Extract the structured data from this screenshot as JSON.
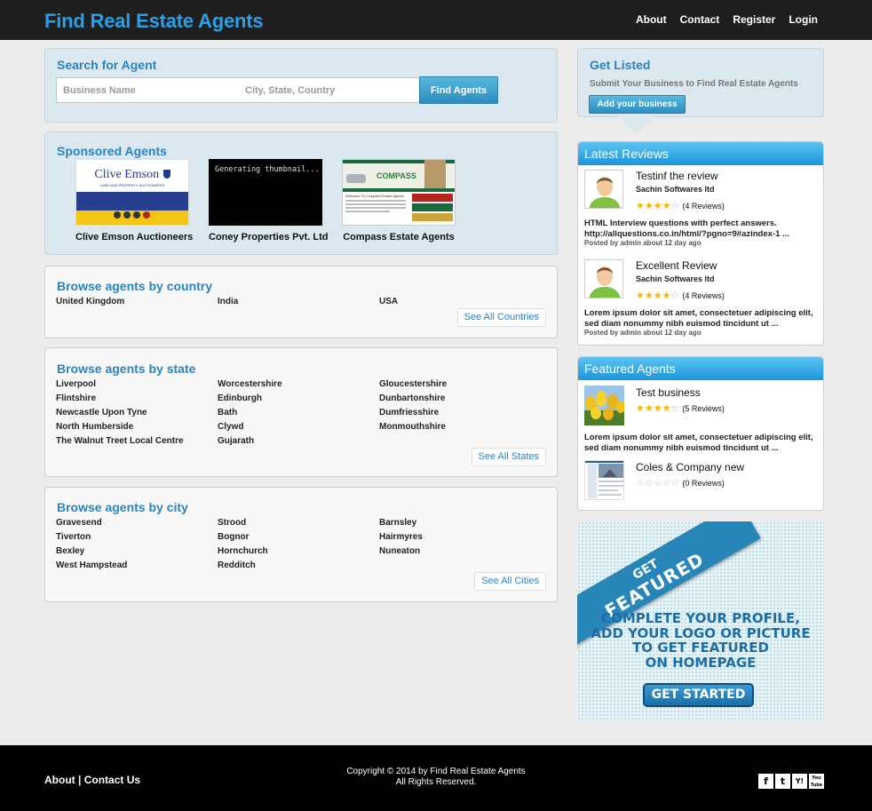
{
  "header": {
    "brand": "Find Real Estate Agents",
    "nav": [
      "About",
      "Contact",
      "Register",
      "Login"
    ]
  },
  "search": {
    "title": "Search for Agent",
    "business_placeholder": "Business Name",
    "location_placeholder": "City, State, Country",
    "button": "Find Agents"
  },
  "sponsored": {
    "title": "Sponsored Agents",
    "items": [
      {
        "name": "Clive Emson Auctioneers",
        "logo_text": "Clive Emson",
        "logo_sub": "LAND AND PROPERTY AUCTIONEERS"
      },
      {
        "name": "Coney Properties Pvt. Ltd",
        "thumb_text": "Generating thumbnail..."
      },
      {
        "name": "Compass Estate Agents",
        "logo_text": "COMPASS",
        "site_heading": "Welcome To Compass Estate Agents"
      }
    ]
  },
  "countries": {
    "title": "Browse agents by country",
    "items": [
      "United Kingdom",
      "India",
      "USA"
    ],
    "see_all": "See All Countries"
  },
  "states": {
    "title": "Browse agents by state",
    "items": [
      "Liverpool",
      "Worcestershire",
      "Gloucestershire",
      "Flintshire",
      "Edinburgh",
      "Dunbartonshire",
      "Newcastle Upon Tyne",
      "Bath",
      "Dumfriesshire",
      "North Humberside",
      "Clywd",
      "Monmouthshire",
      "The Walnut Treet Local Centre",
      "Gujarath"
    ],
    "see_all": "See All States"
  },
  "cities": {
    "title": "Browse agents by city",
    "items": [
      "Gravesend",
      "Strood",
      "Barnsley",
      "Tiverton",
      "Bognor",
      "Hairmyres",
      "Bexley",
      "Hornchurch",
      "Nuneaton",
      "West Hampstead",
      "Redditch"
    ],
    "see_all": "See All Cities"
  },
  "get_listed": {
    "title": "Get Listed",
    "text": "Submit Your Business to Find Real Estate Agents",
    "button": "Add your business"
  },
  "latest_reviews": {
    "title": "Latest Reviews",
    "items": [
      {
        "title": "Testinf the review",
        "company": "Sachin Softwares ltd",
        "rating": 4,
        "count": "(4 Reviews)",
        "body_line1": "HTML Interview questions with perfect answers.",
        "body_line2": "http://allquestions.co.in/html/?pgno=9#azindex-1 ...",
        "meta": "Posted by admin about 12 day ago"
      },
      {
        "title": "Excellent Review",
        "company": "Sachin Softwares ltd",
        "rating": 4,
        "count": "(4 Reviews)",
        "body_line1": "Lorem ipsum dolor sit amet, consectetuer adipiscing elit,",
        "body_line2": "sed diam nonummy nibh euismod tincidunt ut ...",
        "meta": "Posted by admin about 12 day ago"
      }
    ]
  },
  "featured_agents": {
    "title": "Featured Agents",
    "items": [
      {
        "title": "Test business",
        "rating": 4,
        "count": "(5 Reviews)",
        "body_line1": "Lorem ipsum dolor sit amet, consectetuer adipiscing elit,",
        "body_line2": "sed diam nonummy nibh euismod tincidunt ut ..."
      },
      {
        "title": "Coles & Company new",
        "rating": 0,
        "count": "(0 Reviews)"
      }
    ]
  },
  "promo": {
    "ribbon_line1": "GET",
    "ribbon_line2": "FEATURED",
    "line1": "COMPLETE YOUR PROFILE,",
    "line2": "ADD YOUR LOGO OR PICTURE",
    "line3": "TO GET FEATURED",
    "line4": "ON HOMEPAGE",
    "button": "GET STARTED"
  },
  "footer": {
    "about": "About",
    "separator": "|",
    "contact": "Contact Us",
    "copyright": "Copyright © 2014 by Find Real Estate Agents",
    "rights": "All Rights Reserved.",
    "social": [
      "f",
      "t",
      "Y!",
      "You Tube"
    ]
  },
  "colors": {
    "brand": "#2a9fe8",
    "link": "#2a84c2",
    "accent_gradient_top": "#5cc3f2",
    "accent_gradient_bottom": "#1c95d9",
    "star": "#f5b800"
  }
}
